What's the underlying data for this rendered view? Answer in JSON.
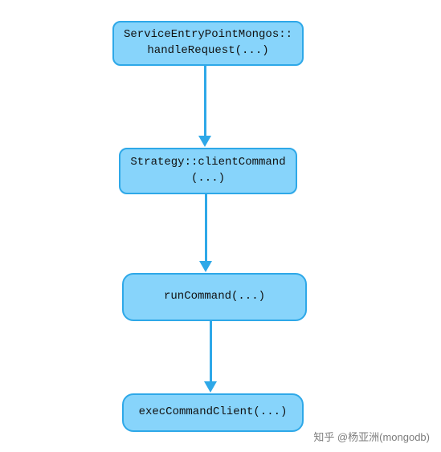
{
  "diagram": {
    "nodes": {
      "n1": {
        "label": "ServiceEntryPointMongos::\nhandleRequest(...)"
      },
      "n2": {
        "label": "Strategy::clientCommand\n(...)"
      },
      "n3": {
        "label": "runCommand(...)"
      },
      "n4": {
        "label": "execCommandClient(...)"
      }
    },
    "edges": [
      {
        "from": "n1",
        "to": "n2"
      },
      {
        "from": "n2",
        "to": "n3"
      },
      {
        "from": "n3",
        "to": "n4"
      }
    ],
    "colors": {
      "node_fill": "#87d4fb",
      "node_border": "#2ea8e8",
      "arrow": "#2ea8e8"
    }
  },
  "watermark": "知乎 @杨亚洲(mongodb)"
}
